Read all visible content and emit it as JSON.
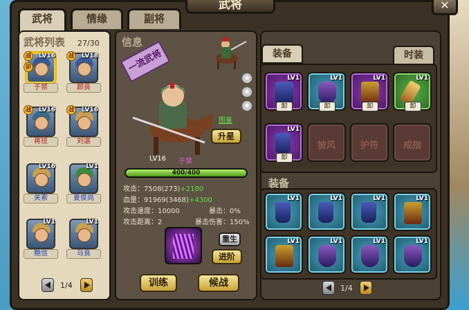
{
  "window": {
    "title": "武将"
  },
  "tabs": [
    "武将",
    "情缘",
    "副将"
  ],
  "roster": {
    "title": "武将列表",
    "count": "27/30",
    "heroes": [
      {
        "level": "LV16",
        "name": "于禁",
        "badges": [
          "战",
          "卯"
        ],
        "selected": true,
        "name_color": "red"
      },
      {
        "level": "LV18",
        "name": "颜良",
        "badges": [
          "战"
        ],
        "selected": false,
        "name_color": "red"
      },
      {
        "level": "LV16",
        "name": "蒋班",
        "badges": [
          "战"
        ],
        "selected": false,
        "name_color": "red"
      },
      {
        "level": "LV16",
        "name": "刘谌",
        "badges": [
          "战"
        ],
        "selected": false,
        "name_color": "red"
      },
      {
        "level": "LV16",
        "name": "关索",
        "badges": [],
        "selected": false,
        "name_color": "blue"
      },
      {
        "level": "LV1",
        "name": "夏侯尚",
        "badges": [],
        "selected": false,
        "name_color": "blue"
      },
      {
        "level": "LV1",
        "name": "鲍信",
        "badges": [],
        "selected": false,
        "name_color": "blue"
      },
      {
        "level": "LV1",
        "name": "马良",
        "badges": [],
        "selected": false,
        "name_color": "blue"
      }
    ],
    "page": "1/4"
  },
  "info": {
    "title": "信息",
    "banner": "一流武将",
    "level": "LV16",
    "name": "于禁",
    "atlas_link": "图鉴",
    "upgrade_button": "升星",
    "hp_bar": {
      "text": "400/400",
      "fraction": 1.0
    },
    "stats": {
      "attack": "攻击：7508(273)",
      "attack_bonus": "+2180",
      "hp": "血量：91969(3468)",
      "hp_bonus": "+4300",
      "attack_speed": "攻击速度：10000",
      "crit": "暴击：0%",
      "attack_range": "攻击距离：2",
      "crit_damage": "暴击伤害：150%"
    },
    "rebirth_button": "重生",
    "advance_button": "进阶",
    "train_button": "训练",
    "battle_button": "候战"
  },
  "equipment": {
    "tab_equip": "装备",
    "tab_fashion": "时装",
    "equipped": [
      {
        "level": "LV1",
        "tag": "卸",
        "rarity": "purple",
        "icon": "sword-icon"
      },
      {
        "level": "LV1",
        "tag": "卸",
        "rarity": "blue",
        "icon": "helmet-icon"
      },
      {
        "level": "LV1",
        "tag": "卸",
        "rarity": "purple",
        "icon": "armor-icon"
      },
      {
        "level": "LV1",
        "tag": "卸",
        "rarity": "green",
        "icon": "horn-icon"
      },
      {
        "level": "LV1",
        "tag": "卸",
        "rarity": "purple",
        "icon": "boots-icon"
      },
      {
        "label": "披风",
        "rarity": "empty"
      },
      {
        "label": "护符",
        "rarity": "empty"
      },
      {
        "label": "戒指",
        "rarity": "empty"
      }
    ],
    "bag_title": "装备",
    "bag": [
      {
        "level": "LV1",
        "icon": "boots-icon"
      },
      {
        "level": "LV1",
        "icon": "boots-icon"
      },
      {
        "level": "LV1",
        "icon": "boots-icon"
      },
      {
        "level": "LV1",
        "icon": "armor-icon"
      },
      {
        "level": "LV1",
        "icon": "armor-icon"
      },
      {
        "level": "LV1",
        "icon": "helmet-icon"
      },
      {
        "level": "LV1",
        "icon": "helmet-icon"
      },
      {
        "level": "LV1",
        "icon": "helmet-icon"
      }
    ],
    "page": "1/4"
  }
}
